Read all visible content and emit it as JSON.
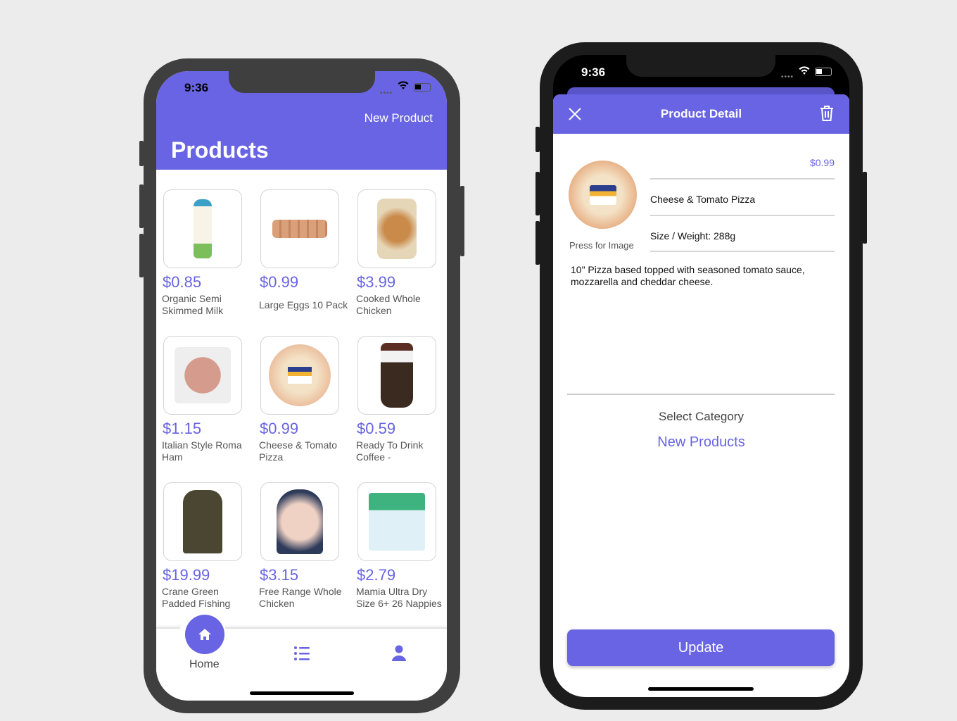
{
  "left": {
    "status_time": "9:36",
    "header_action": "New Product",
    "title": "Products",
    "products": [
      {
        "price": "$0.85",
        "name": "Organic Semi Skimmed Milk",
        "image": "milk-bottle"
      },
      {
        "price": "$0.99",
        "name": "Large Eggs 10 Pack",
        "image": "egg-carton"
      },
      {
        "price": "$3.99",
        "name": "Cooked Whole Chicken",
        "image": "cooked-chicken"
      },
      {
        "price": "$1.15",
        "name": "Italian Style Roma Ham",
        "image": "ham-pack"
      },
      {
        "price": "$0.99",
        "name": "Cheese & Tomato Pizza",
        "image": "pizza"
      },
      {
        "price": "$0.59",
        "name": "Ready To Drink Coffee -",
        "image": "coffee-cup"
      },
      {
        "price": "$19.99",
        "name": "Crane Green Padded Fishing",
        "image": "jacket"
      },
      {
        "price": "$3.15",
        "name": "Free Range Whole Chicken",
        "image": "raw-chicken"
      },
      {
        "price": "$2.79",
        "name": "Mamia Ultra Dry Size 6+ 26 Nappies",
        "image": "nappies"
      }
    ],
    "nav": {
      "home": "Home"
    }
  },
  "right": {
    "status_time": "9:36",
    "header_title": "Product Detail",
    "price": "$0.99",
    "name": "Cheese & Tomato Pizza",
    "size": "Size / Weight: 288g",
    "press_image": "Press for Image",
    "description": "10\" Pizza based topped with seasoned tomato sauce, mozzarella and cheddar cheese.",
    "select_category_label": "Select Category",
    "category": "New Products",
    "update_button": "Update"
  },
  "colors": {
    "accent": "#6864e3",
    "frame_left": "#3f3f3f",
    "frame_right": "#1c1c1c"
  }
}
